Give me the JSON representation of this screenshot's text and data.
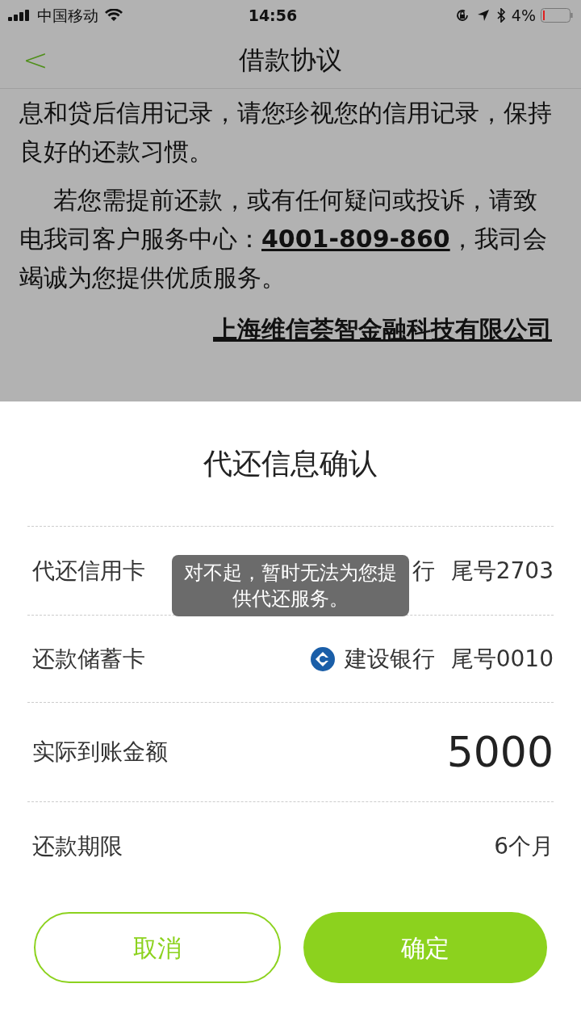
{
  "status_bar": {
    "carrier": "中国移动",
    "time": "14:56",
    "battery": "4%"
  },
  "nav": {
    "back": "<",
    "title": "借款协议"
  },
  "agreement": {
    "paragraphs": [
      {
        "indent": false,
        "text": "息和贷后信用记录，请您珍视您的信用记录，保持良好的还款习惯。"
      },
      {
        "indent": true,
        "text": "若您需提前还款，或有任何疑问或投诉，请致电我司客户服务中心：",
        "link": "4001-809-860",
        "after": "，我司会竭诚为您提供优质服务。"
      }
    ],
    "company": "上海维信荟智金融科技有限公司"
  },
  "sheet": {
    "title": "代还信息确认",
    "rows": [
      {
        "kind": "card",
        "label": "代还信用卡",
        "bank": "行",
        "tail": "尾号2703"
      },
      {
        "kind": "card",
        "label": "还款储蓄卡",
        "bank": "建设银行",
        "tail": "尾号0010",
        "icon": true
      },
      {
        "kind": "amount",
        "label": "实际到账金额",
        "value": "5000"
      },
      {
        "kind": "text",
        "label": "还款期限",
        "value": "6个月"
      }
    ],
    "buttons": [
      {
        "label": "取消",
        "kind": "outline"
      },
      {
        "label": "确定",
        "kind": "filled"
      }
    ]
  },
  "toast": "对不起，暂时无法为您提供代还服务。"
}
